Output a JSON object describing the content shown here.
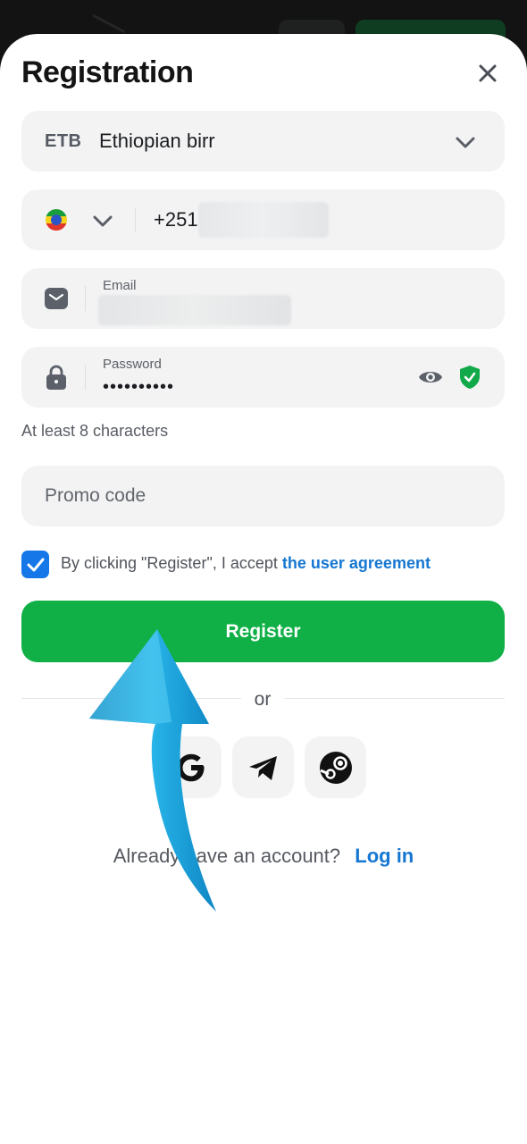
{
  "sheet": {
    "title": "Registration",
    "close_icon": "close-icon"
  },
  "currency": {
    "code": "ETB",
    "name": "Ethiopian birr",
    "icon": "chevron-down-icon"
  },
  "phone": {
    "flag_icon": "ethiopia-flag-icon",
    "country_code": "+251",
    "number_redacted": true
  },
  "email": {
    "label": "Email",
    "value_redacted": true,
    "icon": "envelope-icon"
  },
  "password": {
    "label": "Password",
    "value": "••••••••••",
    "hint": "At least 8 characters",
    "icons": [
      "lock-icon",
      "eye-icon",
      "shield-check-icon"
    ]
  },
  "promo": {
    "placeholder": "Promo code"
  },
  "agreement": {
    "checked": true,
    "text": "By clicking \"Register\", I accept",
    "link": "the user agreement"
  },
  "register_button": {
    "label": "Register",
    "color": "#10b047"
  },
  "divider": {
    "label": "or"
  },
  "social": [
    "google-icon",
    "telegram-icon",
    "steam-icon"
  ],
  "login": {
    "text": "Already have an account?",
    "link": "Log in"
  },
  "colors": {
    "accent": "#1677d2",
    "field_bg": "#f3f3f4",
    "overlay_arrow": "#1a9fd6"
  }
}
